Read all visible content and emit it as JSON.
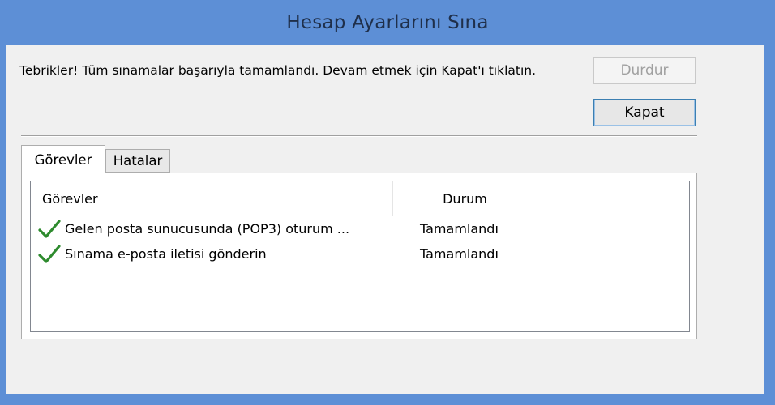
{
  "window": {
    "title": "Hesap Ayarlarını Sına"
  },
  "message": {
    "text": "Tebrikler! Tüm sınamalar başarıyla tamamlandı. Devam etmek için Kapat'ı tıklatın."
  },
  "buttons": {
    "stop_label": "Durdur",
    "close_label": "Kapat"
  },
  "tabs": [
    {
      "label": "Görevler",
      "active": true
    },
    {
      "label": "Hatalar",
      "active": false
    }
  ],
  "table": {
    "columns": [
      "Görevler",
      "Durum",
      ""
    ],
    "rows": [
      {
        "icon": "green-check-icon",
        "task": "Gelen posta sunucusunda (POP3) oturum ...",
        "status": "Tamamlandı"
      },
      {
        "icon": "green-check-icon",
        "task": "Sınama e-posta iletisi gönderin",
        "status": "Tamamlandı"
      }
    ]
  },
  "colors": {
    "title_bar": "#5d8fd6",
    "check": "#2e8b2e"
  }
}
